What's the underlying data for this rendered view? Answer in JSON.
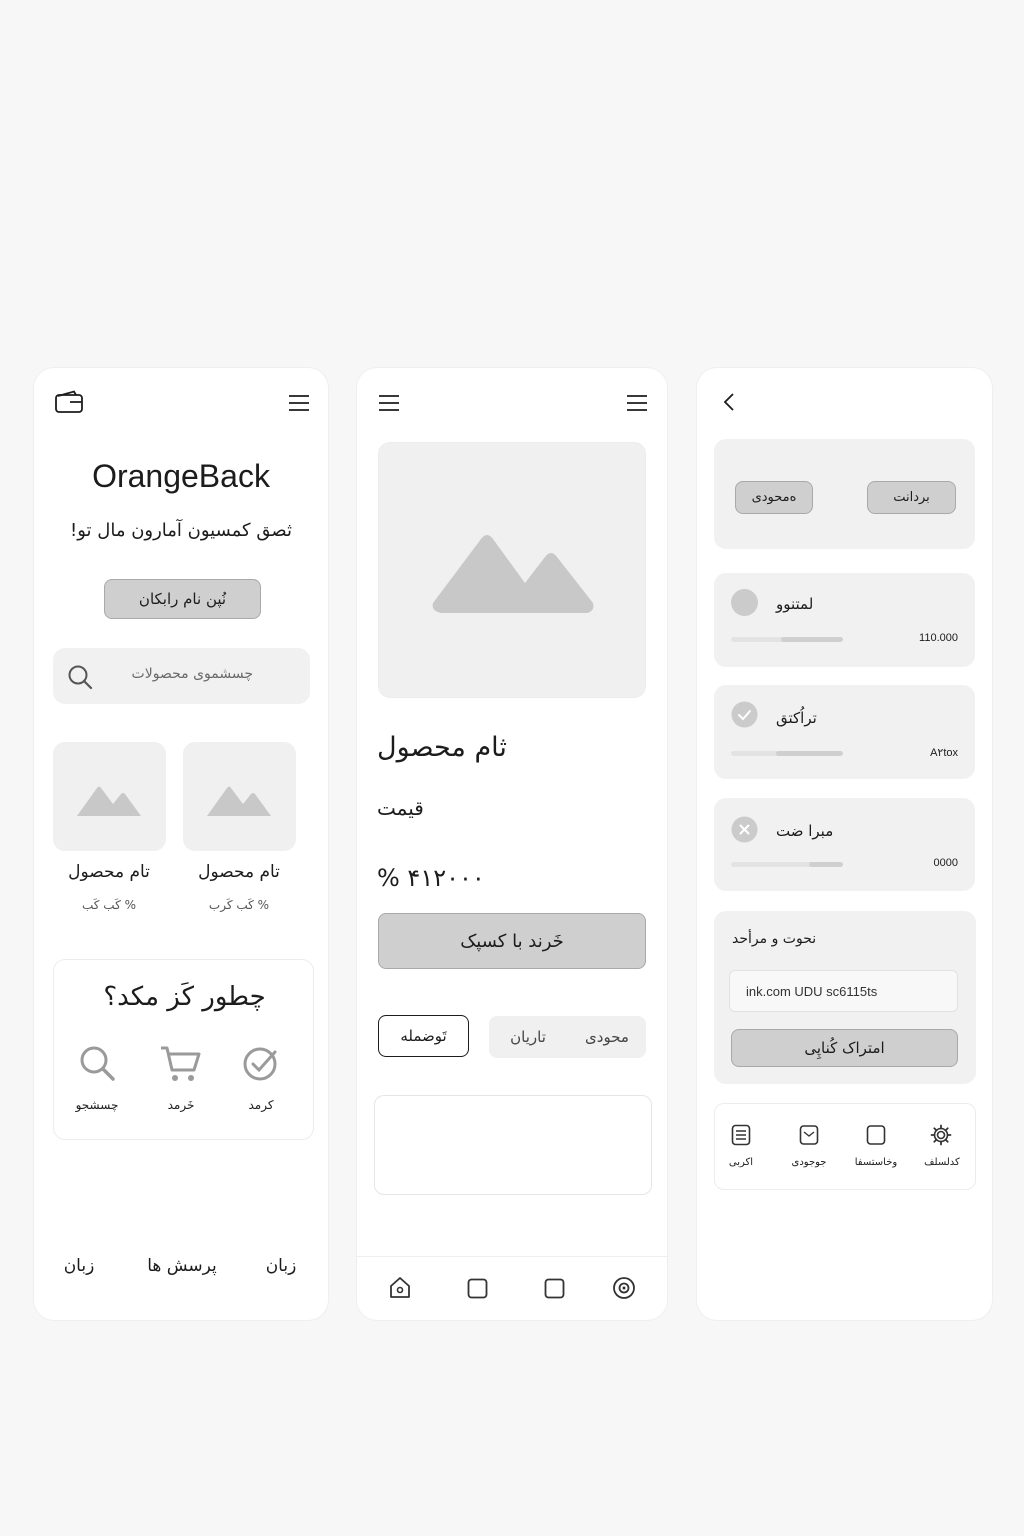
{
  "screen1": {
    "brand": "OrangeBack",
    "tagline": "ثصق کمسیون آمارون مال تو!",
    "cta_button": "نُپن نام رابکان",
    "search": {
      "placeholder": "چسشموی محصولات"
    },
    "products": [
      {
        "name": "تام محصول",
        "price": "%  کَب کَب"
      },
      {
        "name": "تام محصول",
        "price": "%  کَب کَرب"
      }
    ],
    "how_it_works": {
      "title": "چطور کَز مکد؟",
      "steps": [
        {
          "label": "چسشجو",
          "icon": "search-icon"
        },
        {
          "label": "خَرمد",
          "icon": "cart-icon"
        },
        {
          "label": "کرمد",
          "icon": "check-circle-icon"
        }
      ]
    },
    "footer_links": [
      "زبان",
      "پرسش ها",
      "زبان"
    ]
  },
  "screen2": {
    "product_title": "ثام محصول",
    "price_label": "قیمت",
    "price_value": "% ۴۱۲۰۰۰",
    "buy_button": "خَرند با کسپک",
    "tabs": {
      "outline": "تَوضمله",
      "chip_left": "تاریان",
      "chip_right": "محودی"
    },
    "bottom_nav": [
      "home-icon",
      "square-icon",
      "square-icon",
      "target-icon"
    ]
  },
  "screen3": {
    "top_buttons": {
      "left": "ەمحودی",
      "right": "بردانت"
    },
    "items": [
      {
        "label": "لمتنوو",
        "value": "110.000",
        "progress": 0.55,
        "status": "empty"
      },
      {
        "label": "تراُکتق",
        "value": "A۲tox",
        "progress": 0.6,
        "status": "check"
      },
      {
        "label": "مبرا ضت",
        "value": "0000",
        "progress": 0.3,
        "status": "cross"
      }
    ],
    "referral": {
      "title": "نحوت و مرأحد",
      "link": "ink.com UDU sc6115ts",
      "share_button": "امتراک کُناپِی"
    },
    "tabbar": [
      {
        "label": "اکربی",
        "icon": "document-icon"
      },
      {
        "label": "جوجودی",
        "icon": "wallet-icon"
      },
      {
        "label": "وخاستسفا",
        "icon": "square-icon"
      },
      {
        "label": "کدلسلف",
        "icon": "gear-icon"
      }
    ]
  },
  "colors": {
    "background": "#f7f7f7",
    "card": "#ffffff",
    "panel": "#f1f1f1",
    "button": "#cfcfcf",
    "icon": "#a6a6a6",
    "text": "#1c1c1c"
  }
}
